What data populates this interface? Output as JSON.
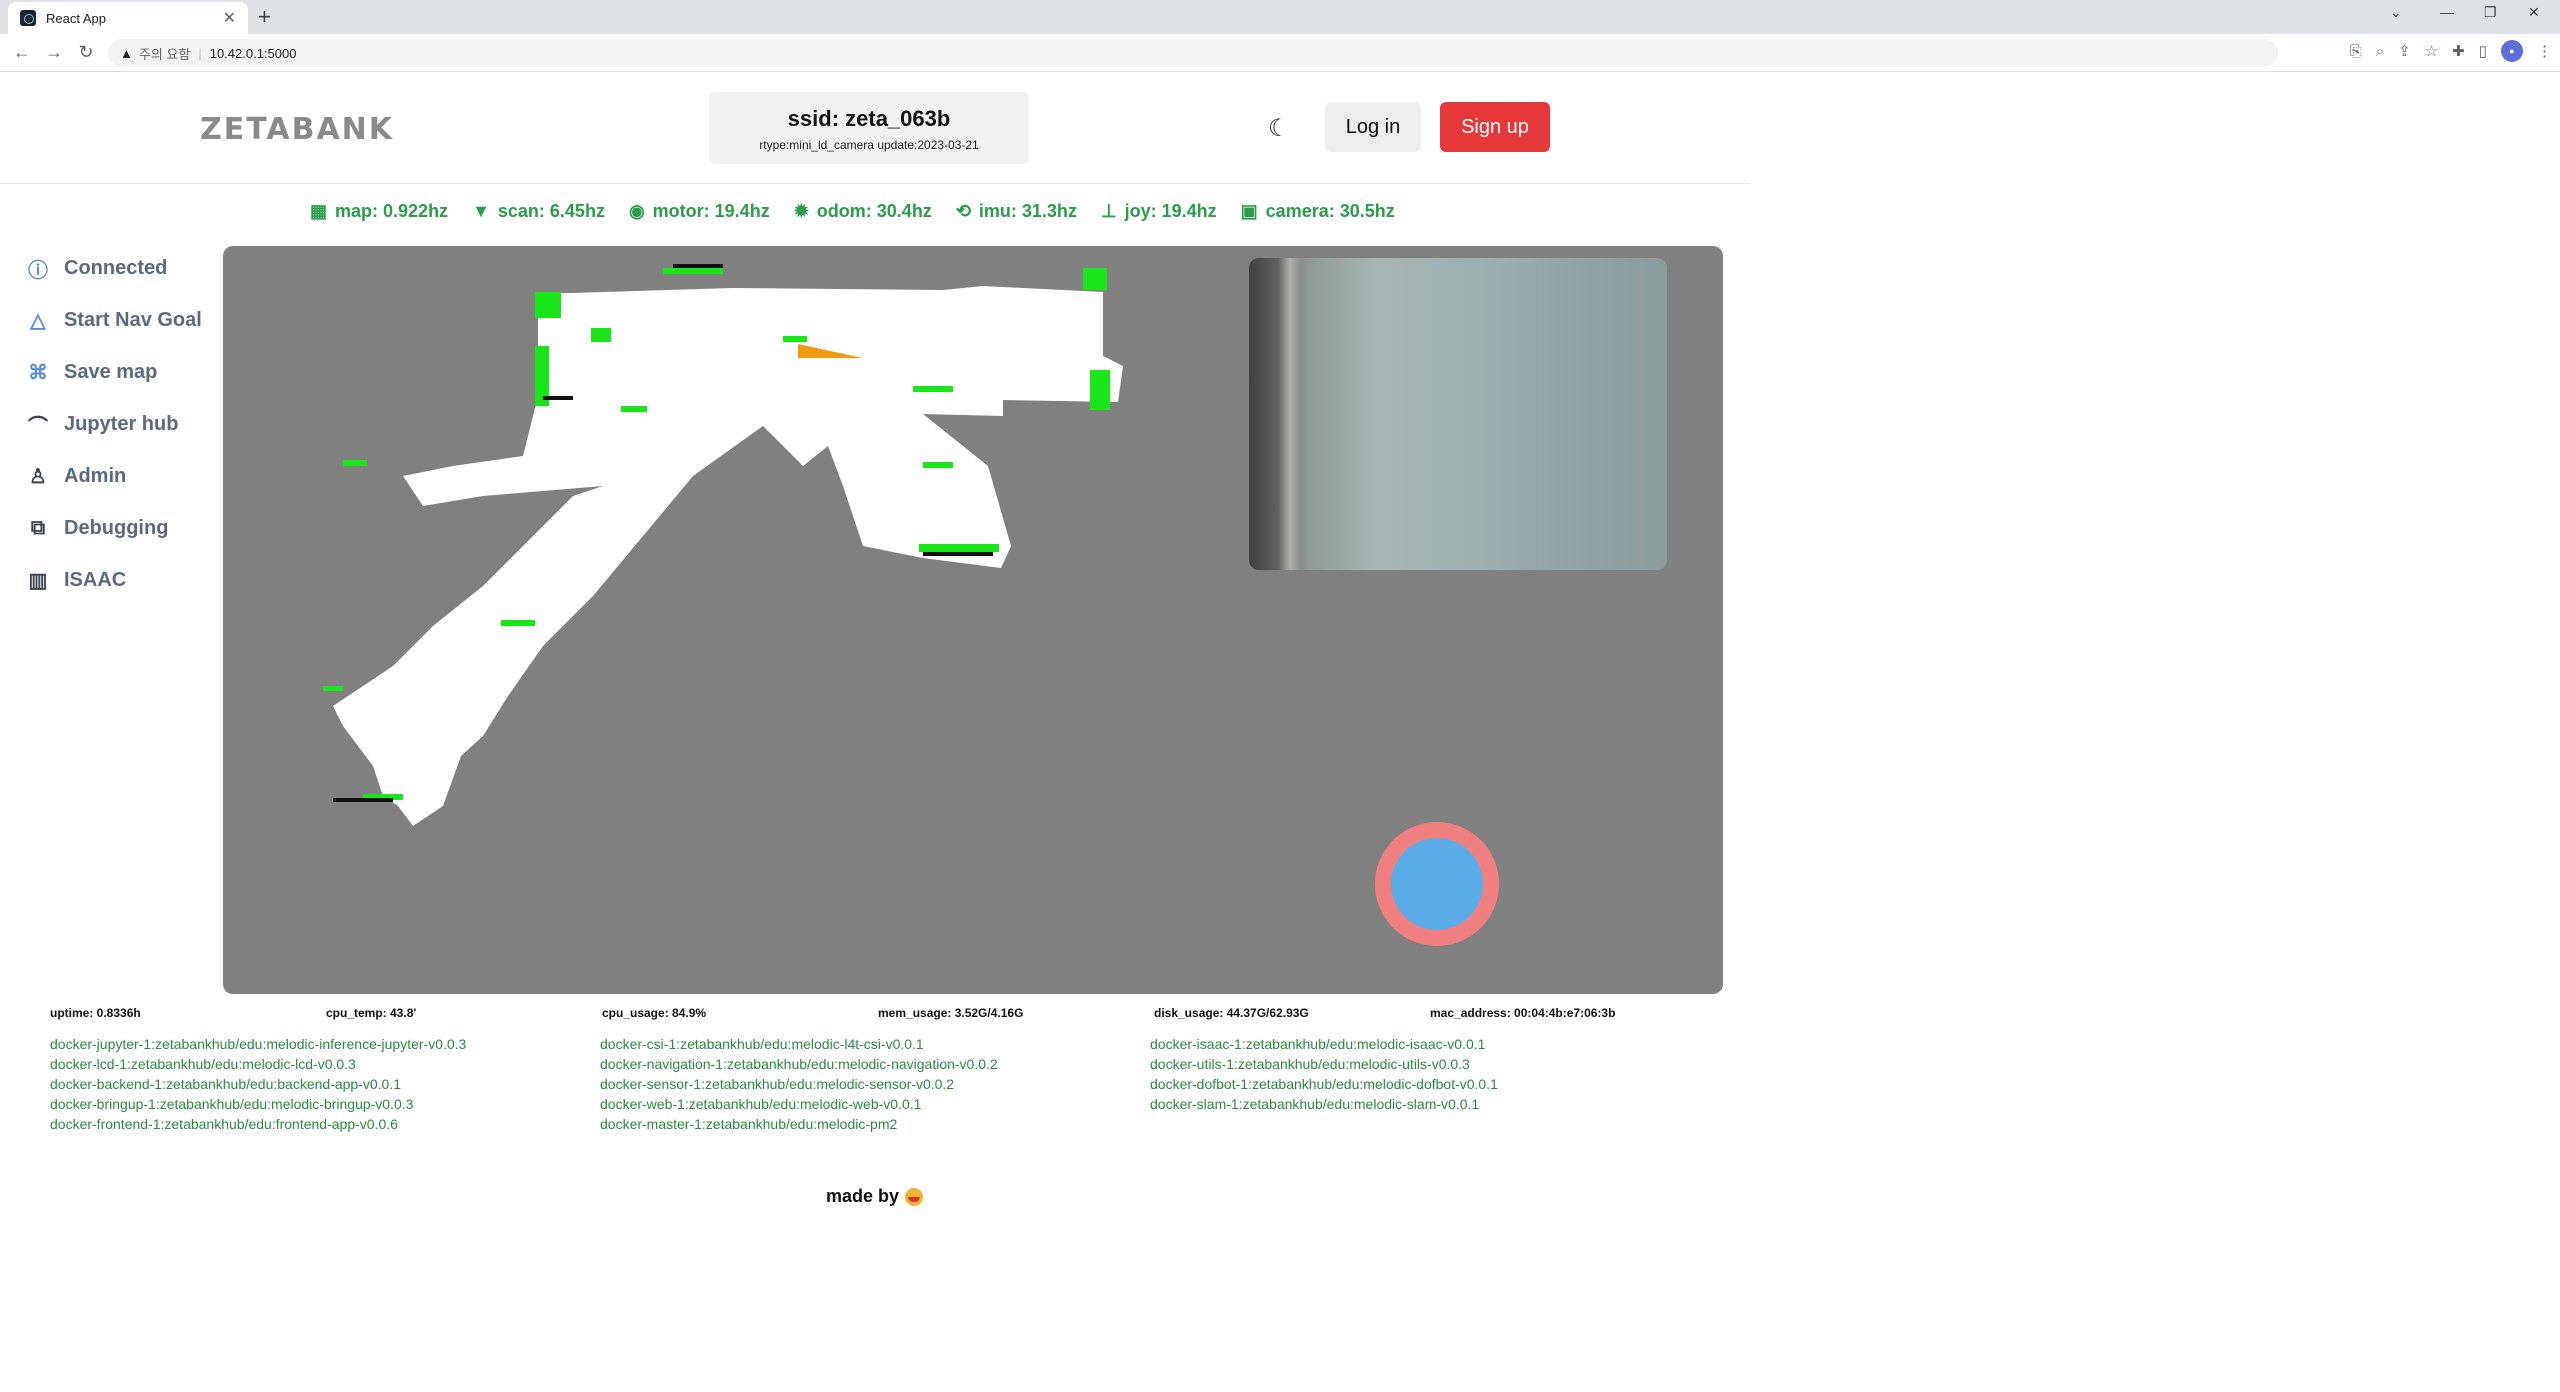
{
  "browser": {
    "tab_title": "React App",
    "address_warning": "주의 요함",
    "address_url": "10.42.0.1:5000"
  },
  "header": {
    "logo": "ZETABANK",
    "ssid_title": "ssid: zeta_063b",
    "ssid_sub": "rtype:mini_ld_camera update:2023-03-21",
    "login_label": "Log in",
    "signup_label": "Sign up"
  },
  "rates": [
    {
      "icon": "grid-icon",
      "label": "map: 0.922hz"
    },
    {
      "icon": "wifi-icon",
      "label": "scan: 6.45hz"
    },
    {
      "icon": "motor-icon",
      "label": "motor: 19.4hz"
    },
    {
      "icon": "gear-icon",
      "label": "odom: 30.4hz"
    },
    {
      "icon": "imu-icon",
      "label": "imu: 31.3hz"
    },
    {
      "icon": "joystick-icon",
      "label": "joy: 19.4hz"
    },
    {
      "icon": "camera-icon",
      "label": "camera: 30.5hz"
    }
  ],
  "sidebar": {
    "items": [
      {
        "icon": "bolt-icon",
        "label": "Connected"
      },
      {
        "icon": "navigation-icon",
        "label": "Start Nav Goal"
      },
      {
        "icon": "map-icon",
        "label": "Save map"
      },
      {
        "icon": "jupyter-icon",
        "label": "Jupyter hub"
      },
      {
        "icon": "user-icon",
        "label": "Admin"
      },
      {
        "icon": "debug-icon",
        "label": "Debugging"
      },
      {
        "icon": "chart-icon",
        "label": "ISAAC"
      }
    ]
  },
  "stats": {
    "uptime": "uptime: 0.8336h",
    "cpu_temp": "cpu_temp: 43.8'",
    "cpu_usage": "cpu_usage: 84.9%",
    "mem_usage": "mem_usage: 3.52G/4.16G",
    "disk_usage": "disk_usage: 44.37G/62.93G",
    "mac_address": "mac_address: 00:04:4b:e7:06:3b"
  },
  "dockers": {
    "col1": [
      "docker-jupyter-1:zetabankhub/edu:melodic-inference-jupyter-v0.0.3",
      "docker-lcd-1:zetabankhub/edu:melodic-lcd-v0.0.3",
      "docker-backend-1:zetabankhub/edu:backend-app-v0.0.1",
      "docker-bringup-1:zetabankhub/edu:melodic-bringup-v0.0.3",
      "docker-frontend-1:zetabankhub/edu:frontend-app-v0.0.6"
    ],
    "col2": [
      "docker-csi-1:zetabankhub/edu:melodic-l4t-csi-v0.0.1",
      "docker-navigation-1:zetabankhub/edu:melodic-navigation-v0.0.2",
      "docker-sensor-1:zetabankhub/edu:melodic-sensor-v0.0.2",
      "docker-web-1:zetabankhub/edu:melodic-web-v0.0.1",
      "docker-master-1:zetabankhub/edu:melodic-pm2"
    ],
    "col3": [
      "docker-isaac-1:zetabankhub/edu:melodic-isaac-v0.0.1",
      "docker-utils-1:zetabankhub/edu:melodic-utils-v0.0.3",
      "docker-dofbot-1:zetabankhub/edu:melodic-dofbot-v0.0.1",
      "docker-slam-1:zetabankhub/edu:melodic-slam-v0.0.1"
    ]
  },
  "footer": {
    "made_by": "made by"
  }
}
